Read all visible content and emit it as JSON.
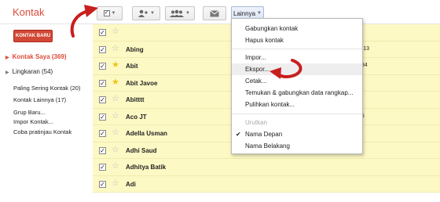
{
  "app": {
    "title": "Kontak"
  },
  "toolbar": {
    "more_label": "Lainnya"
  },
  "sidebar": {
    "new_button": "KONTAK BARU",
    "items": [
      {
        "label": "Kontak Saya (369)"
      },
      {
        "label": "Lingkaran (54)"
      }
    ],
    "groups": [
      {
        "label": "Paling Sering Kontak (20)"
      },
      {
        "label": "Kontak Lainnya (17)"
      }
    ],
    "links": [
      {
        "label": "Grup Baru..."
      },
      {
        "label": "Impor Kontak..."
      },
      {
        "label": "Coba pratinjau Kontak"
      }
    ]
  },
  "contacts": [
    {
      "name": "",
      "starred": false,
      "info": "9)"
    },
    {
      "name": "Abing",
      "starred": false,
      "info": "5-13"
    },
    {
      "name": "Abit",
      "starred": true,
      "info": "934"
    },
    {
      "name": "Abit Javoe",
      "starred": true,
      "info": ""
    },
    {
      "name": "Abitttt",
      "starred": false,
      "info": "8"
    },
    {
      "name": "Aco JT",
      "starred": false,
      "info": "96"
    },
    {
      "name": "Adella Usman",
      "starred": false,
      "info": ""
    },
    {
      "name": "Adhi Saud",
      "starred": false,
      "info": ""
    },
    {
      "name": "Adhitya Batik",
      "starred": false,
      "info": ""
    },
    {
      "name": "Adi",
      "starred": false,
      "info": ""
    }
  ],
  "menu": {
    "items": [
      "Gabungkan kontak",
      "Hapus kontak",
      "Impor...",
      "Ekspor...",
      "Cetak...",
      "Temukan & gabungkan data rangkap...",
      "Pulihkan kontak..."
    ],
    "sort_header": "Urutkan",
    "sort_options": [
      "Nama Depan",
      "Nama Belakang"
    ],
    "sort_selected": "Nama Depan"
  },
  "colors": {
    "accent": "#dd4b39",
    "row_highlight": "#fdf9c4",
    "arrow": "#c81e1e",
    "star": "#f0c419"
  }
}
